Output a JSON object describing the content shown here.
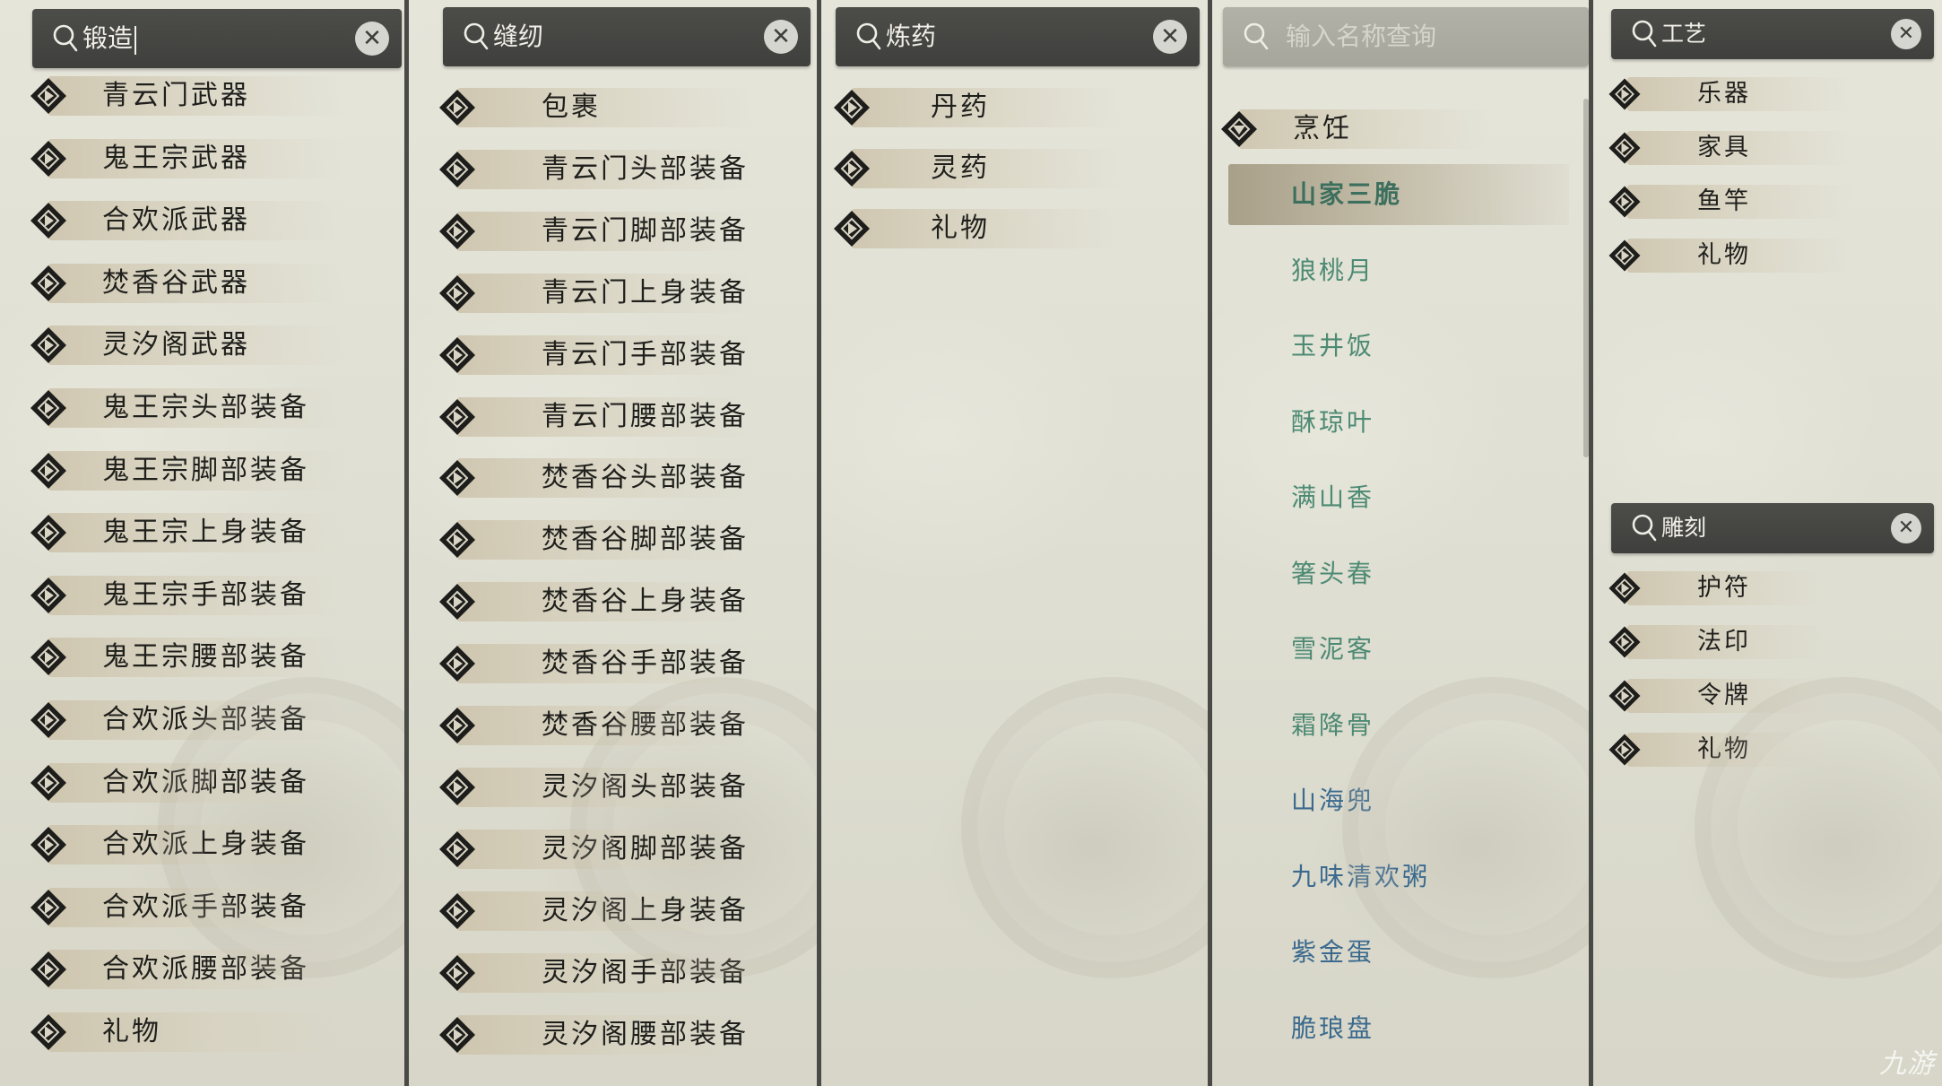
{
  "panels": [
    {
      "search": {
        "value": "锻造",
        "has_clear": true
      },
      "items": [
        "青云门武器",
        "鬼王宗武器",
        "合欢派武器",
        "焚香谷武器",
        "灵汐阁武器",
        "鬼王宗头部装备",
        "鬼王宗脚部装备",
        "鬼王宗上身装备",
        "鬼王宗手部装备",
        "鬼王宗腰部装备",
        "合欢派头部装备",
        "合欢派脚部装备",
        "合欢派上身装备",
        "合欢派手部装备",
        "合欢派腰部装备",
        "礼物"
      ]
    },
    {
      "search": {
        "value": "缝纫",
        "has_clear": true
      },
      "items": [
        "包裹",
        "青云门头部装备",
        "青云门脚部装备",
        "青云门上身装备",
        "青云门手部装备",
        "青云门腰部装备",
        "焚香谷头部装备",
        "焚香谷脚部装备",
        "焚香谷上身装备",
        "焚香谷手部装备",
        "焚香谷腰部装备",
        "灵汐阁头部装备",
        "灵汐阁脚部装备",
        "灵汐阁上身装备",
        "灵汐阁手部装备",
        "灵汐阁腰部装备"
      ]
    },
    {
      "search": {
        "value": "炼药",
        "has_clear": true
      },
      "items": [
        "丹药",
        "灵药",
        "礼物"
      ]
    },
    {
      "search": {
        "placeholder": "输入名称查询"
      },
      "category": "烹饪",
      "subitems": [
        "山家三脆",
        "狼桃月",
        "玉井饭",
        "酥琼叶",
        "满山香",
        "箸头春",
        "雪泥客",
        "霜降骨",
        "山海兜",
        "九味清欢粥",
        "紫金蛋",
        "脆琅盘"
      ],
      "selected_subitem": "山家三脆",
      "colors": {
        "selected": "#3d6f5e",
        "green": "#4d8a73",
        "blue": "#3b6a8e"
      }
    },
    {
      "search_top": {
        "value": "工艺",
        "has_clear": true
      },
      "items_top": [
        "乐器",
        "家具",
        "鱼竿",
        "礼物"
      ],
      "search_bottom": {
        "value": "雕刻",
        "has_clear": true
      },
      "items_bottom": [
        "护符",
        "法印",
        "令牌",
        "礼物"
      ]
    }
  ],
  "watermark": "九游"
}
